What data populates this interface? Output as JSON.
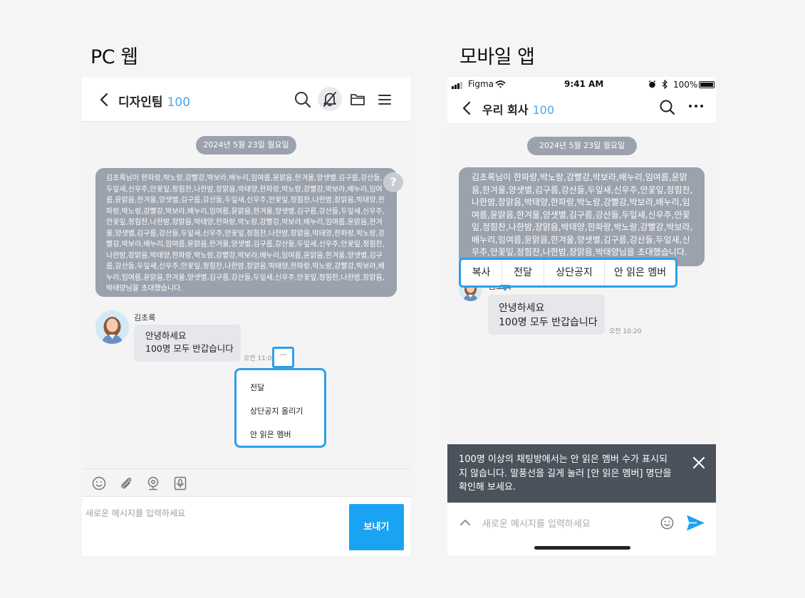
{
  "titles": {
    "pc": "PC 웹",
    "mobile": "모바일 앱"
  },
  "pc": {
    "chat_title": "디자인팀",
    "member_count": "100",
    "date_divider": "2024년 5월 23일 월요일",
    "system_notice": "김초록님이 한파랑,박노랑,강빨강,박보라,배누리,임여름,윤맑음,한겨울,양샛별,김구름,강산들,두잎새,신우주,안꽃잎,정힘찬,나한밤,장맑음,박태양,한파랑,박노랑,강빨강,박보라,배누리,임여름,윤맑음,한겨울,양샛별,김구름,강산들,두잎새,신우주,안꽃잎,정힘찬,나한밤,장맑음,박태양,한파랑,박노랑,강빨강,박보라,배누리,임여름,윤맑음,한겨울,양샛별,김구름,강산들,두잎새,신우주,안꽃잎,정힘찬,나한밤,장맑음,박태양,한파랑,박노랑,강빨강,박보라,배누리,임여름,윤맑음,한겨울,양샛별,김구름,강산들,두잎새,신우주,안꽃잎,정힘찬,나한밤,장맑음,박태양,한파랑,박노랑,강빨강,박보라,배누리,임여름,윤맑음,한겨울,양샛별,김구름,강산들,두잎새,신우주,안꽃잎,정힘찬,나한밤,장맑음,박태양,한파랑,박노랑,강빨강,박보라,배누리,임여름,윤맑음,한겨울,양샛별,김구름,강산들,두잎새,신우주,안꽃잎,정힘찬,나한밤,장맑음,박태양,한파랑,박노랑,강빨강,박보라,배누리,임여름,윤맑음,한겨울,양샛별,김구름,강산들,두잎새,신우주,안꽃잎,정힘찬,나한밤,장맑음,박태양님을 초대했습니다.",
    "help_icon_label": "?",
    "message": {
      "sender": "김초록",
      "line1": "안녕하세요",
      "line2": "100명 모두 반갑습니다",
      "time": "오전 11:0",
      "more": "···"
    },
    "context_menu": [
      "전달",
      "상단공지 올리기",
      "안 읽은 멤버"
    ],
    "input_placeholder": "새로운 메시지를 입력하세요",
    "send_label": "보내기"
  },
  "mobile": {
    "status": {
      "carrier": "Figma",
      "time": "9:41 AM",
      "battery": "100%"
    },
    "chat_title": "우리 회사",
    "member_count": "100",
    "date_divider": "2024년 5월 23일 월요일",
    "system_notice": "김초록님이 한파랑,박노랑,강빨강,박보라,배누리,임여름,윤맑음,한겨울,양샛별,김구름,강산들,두잎새,신우주,안꽃잎,정힘찬,나한밤,장맑음,박태양,한파랑,박노랑,강빨강,박보라,배누리,임여름,윤맑음,한겨울,양샛별,김구름,강산들,두잎새,신우주,안꽃잎,정힘찬,나한밤,장맑음,박태양,한파랑,박노랑,강빨강,박보라,배누리,임여름,윤맑음,한겨울,양샛별,김구름,강산들,두잎새,신우주,안꽃잎,정힘찬,나한밤,장맑음,박태양님을 초대했습니다.",
    "context_menu": [
      "복사",
      "전달",
      "상단공지",
      "안 읽은 멤버"
    ],
    "message": {
      "sender": "김초록",
      "line1": "안녕하세요",
      "line2": "100명 모두 반갑습니다",
      "time": "오전 10:20"
    },
    "toast": "100명 이상의 채팅방에서는 안 읽은 멤버 수가 표시되지 않습니다. 말풍선을 길게 눌러 [안 읽은 멤버] 명단을 확인해 보세요.",
    "input_placeholder": "새로운 메시지를 입력하세요"
  },
  "colors": {
    "accent": "#2e9fe8",
    "send_button": "#1aa3f2",
    "notice_bg": "#9ba2ad",
    "toast_bg": "#4b525b",
    "count": "#48a8e6"
  }
}
